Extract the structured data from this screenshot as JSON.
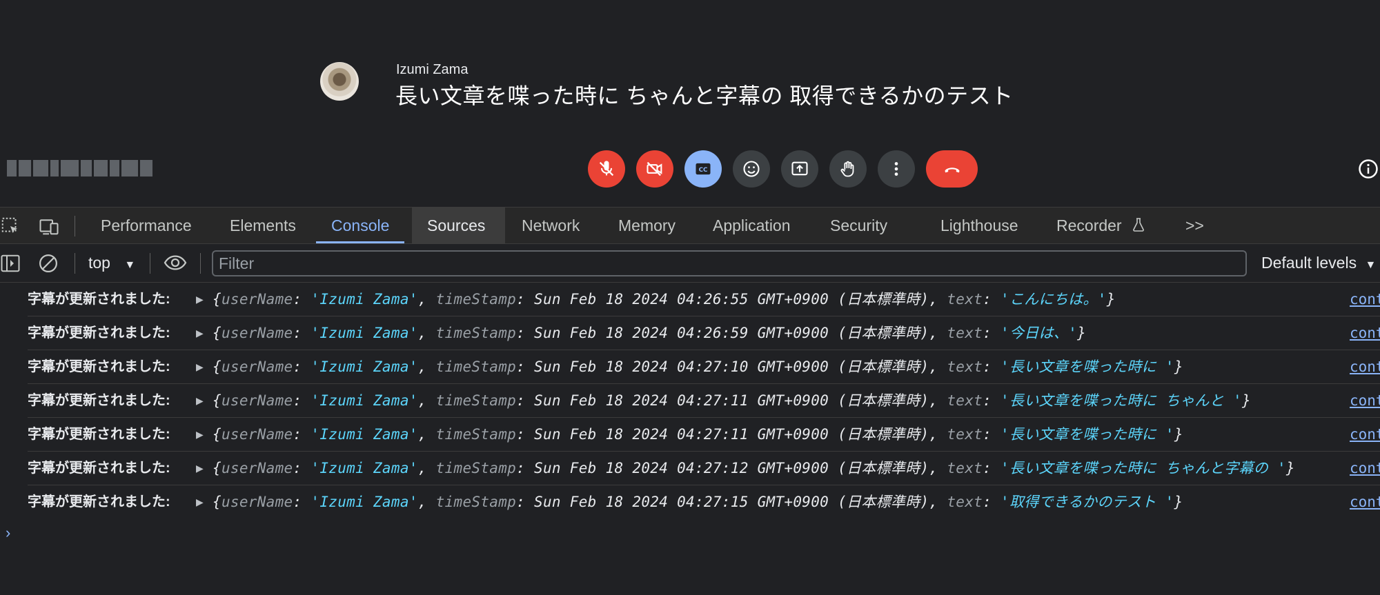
{
  "meet": {
    "speaker_name": "Izumi Zama",
    "caption": "長い文章を喋った時に ちゃんと字幕の 取得できるかのテスト",
    "controls": [
      {
        "name": "mic-off-button",
        "icon": "mic-off-icon",
        "color": "#ea4335"
      },
      {
        "name": "camera-off-button",
        "icon": "camera-off-icon",
        "color": "#ea4335"
      },
      {
        "name": "captions-button",
        "icon": "closed-captions-icon",
        "color": "#8ab4f8"
      },
      {
        "name": "reactions-button",
        "icon": "smiley-icon",
        "color": "#3c4043"
      },
      {
        "name": "present-button",
        "icon": "present-screen-icon",
        "color": "#3c4043"
      },
      {
        "name": "raise-hand-button",
        "icon": "hand-icon",
        "color": "#3c4043"
      },
      {
        "name": "more-options-button",
        "icon": "more-vert-icon",
        "color": "#3c4043"
      },
      {
        "name": "leave-call-button",
        "icon": "phone-hangup-icon",
        "color": "#ea4335"
      }
    ]
  },
  "devtools": {
    "tabs": [
      "Performance",
      "Elements",
      "Console",
      "Sources",
      "Network",
      "Memory",
      "Application",
      "Security",
      "Lighthouse",
      "Recorder"
    ],
    "active_tab": "Console",
    "hovered_tab": "Sources",
    "more_tabs": ">>",
    "context": "top",
    "filter_placeholder": "Filter",
    "levels": "Default levels",
    "prompt": "›",
    "log": {
      "prefix": "字幕が更新されました:",
      "source": "cont",
      "key_userName": "userName",
      "key_timeStamp": "timeStamp",
      "key_text": "text",
      "entries": [
        {
          "userName": "'Izumi Zama'",
          "timeStamp": "Sun Feb 18 2024 04:26:55 GMT+0900 (日本標準時)",
          "text": "'こんにちは。'"
        },
        {
          "userName": "'Izumi Zama'",
          "timeStamp": "Sun Feb 18 2024 04:26:59 GMT+0900 (日本標準時)",
          "text": "'今日は、'"
        },
        {
          "userName": "'Izumi Zama'",
          "timeStamp": "Sun Feb 18 2024 04:27:10 GMT+0900 (日本標準時)",
          "text": "'長い文章を喋った時に '"
        },
        {
          "userName": "'Izumi Zama'",
          "timeStamp": "Sun Feb 18 2024 04:27:11 GMT+0900 (日本標準時)",
          "text": "'長い文章を喋った時に ちゃんと '"
        },
        {
          "userName": "'Izumi Zama'",
          "timeStamp": "Sun Feb 18 2024 04:27:11 GMT+0900 (日本標準時)",
          "text": "'長い文章を喋った時に '"
        },
        {
          "userName": "'Izumi Zama'",
          "timeStamp": "Sun Feb 18 2024 04:27:12 GMT+0900 (日本標準時)",
          "text": "'長い文章を喋った時に ちゃんと字幕の '"
        },
        {
          "userName": "'Izumi Zama'",
          "timeStamp": "Sun Feb 18 2024 04:27:15 GMT+0900 (日本標準時)",
          "text": "'取得できるかのテスト '"
        }
      ]
    }
  }
}
